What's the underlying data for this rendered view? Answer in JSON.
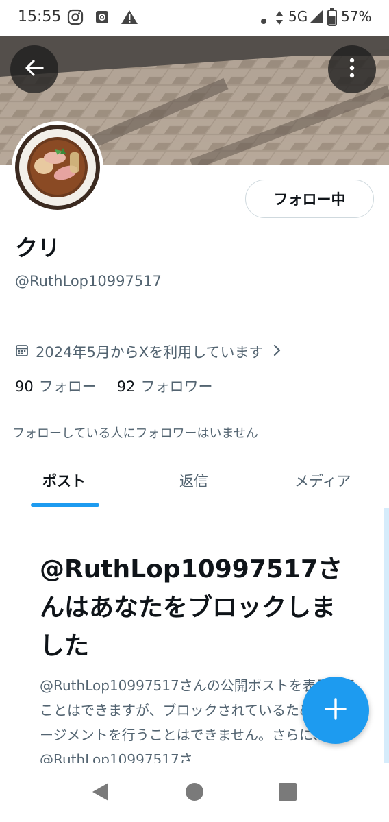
{
  "status_bar": {
    "time": "15:55",
    "network": "5G",
    "battery": "57%",
    "icons": [
      "instagram-icon",
      "settings-notification-icon",
      "warning-icon",
      "dot-icon",
      "data-arrows-icon",
      "signal-icon",
      "battery-icon"
    ]
  },
  "header": {
    "back_icon": "back-arrow-icon",
    "more_icon": "more-vertical-icon"
  },
  "profile": {
    "display_name": "クリ",
    "handle": "@RuthLop10997517",
    "follow_button_label": "フォロー中",
    "joined_text": "2024年5月からXを利用しています",
    "following_count": "90",
    "following_label": "フォロー",
    "followers_count": "92",
    "followers_label": "フォロワー",
    "mutual_note": "フォローしている人にフォロワーはいません"
  },
  "tabs": [
    {
      "label": "ポスト",
      "active": true
    },
    {
      "label": "返信",
      "active": false
    },
    {
      "label": "メディア",
      "active": false
    }
  ],
  "blocked": {
    "title": "@RuthLop10997517さんはあなたをブロックしました",
    "body": "@RuthLop10997517さんの公開ポストを表示することはできますが、ブロックされているためエンゲージメントを行うことはできません。さらに、@RuthLop10997517さ"
  },
  "fab": {
    "icon": "plus-icon"
  },
  "nav": {
    "icons": [
      "nav-back-icon",
      "nav-home-icon",
      "nav-recents-icon"
    ]
  },
  "colors": {
    "accent": "#1d9bf0",
    "text_primary": "#0f1419",
    "text_secondary": "#536471",
    "border": "#cfd9de"
  }
}
